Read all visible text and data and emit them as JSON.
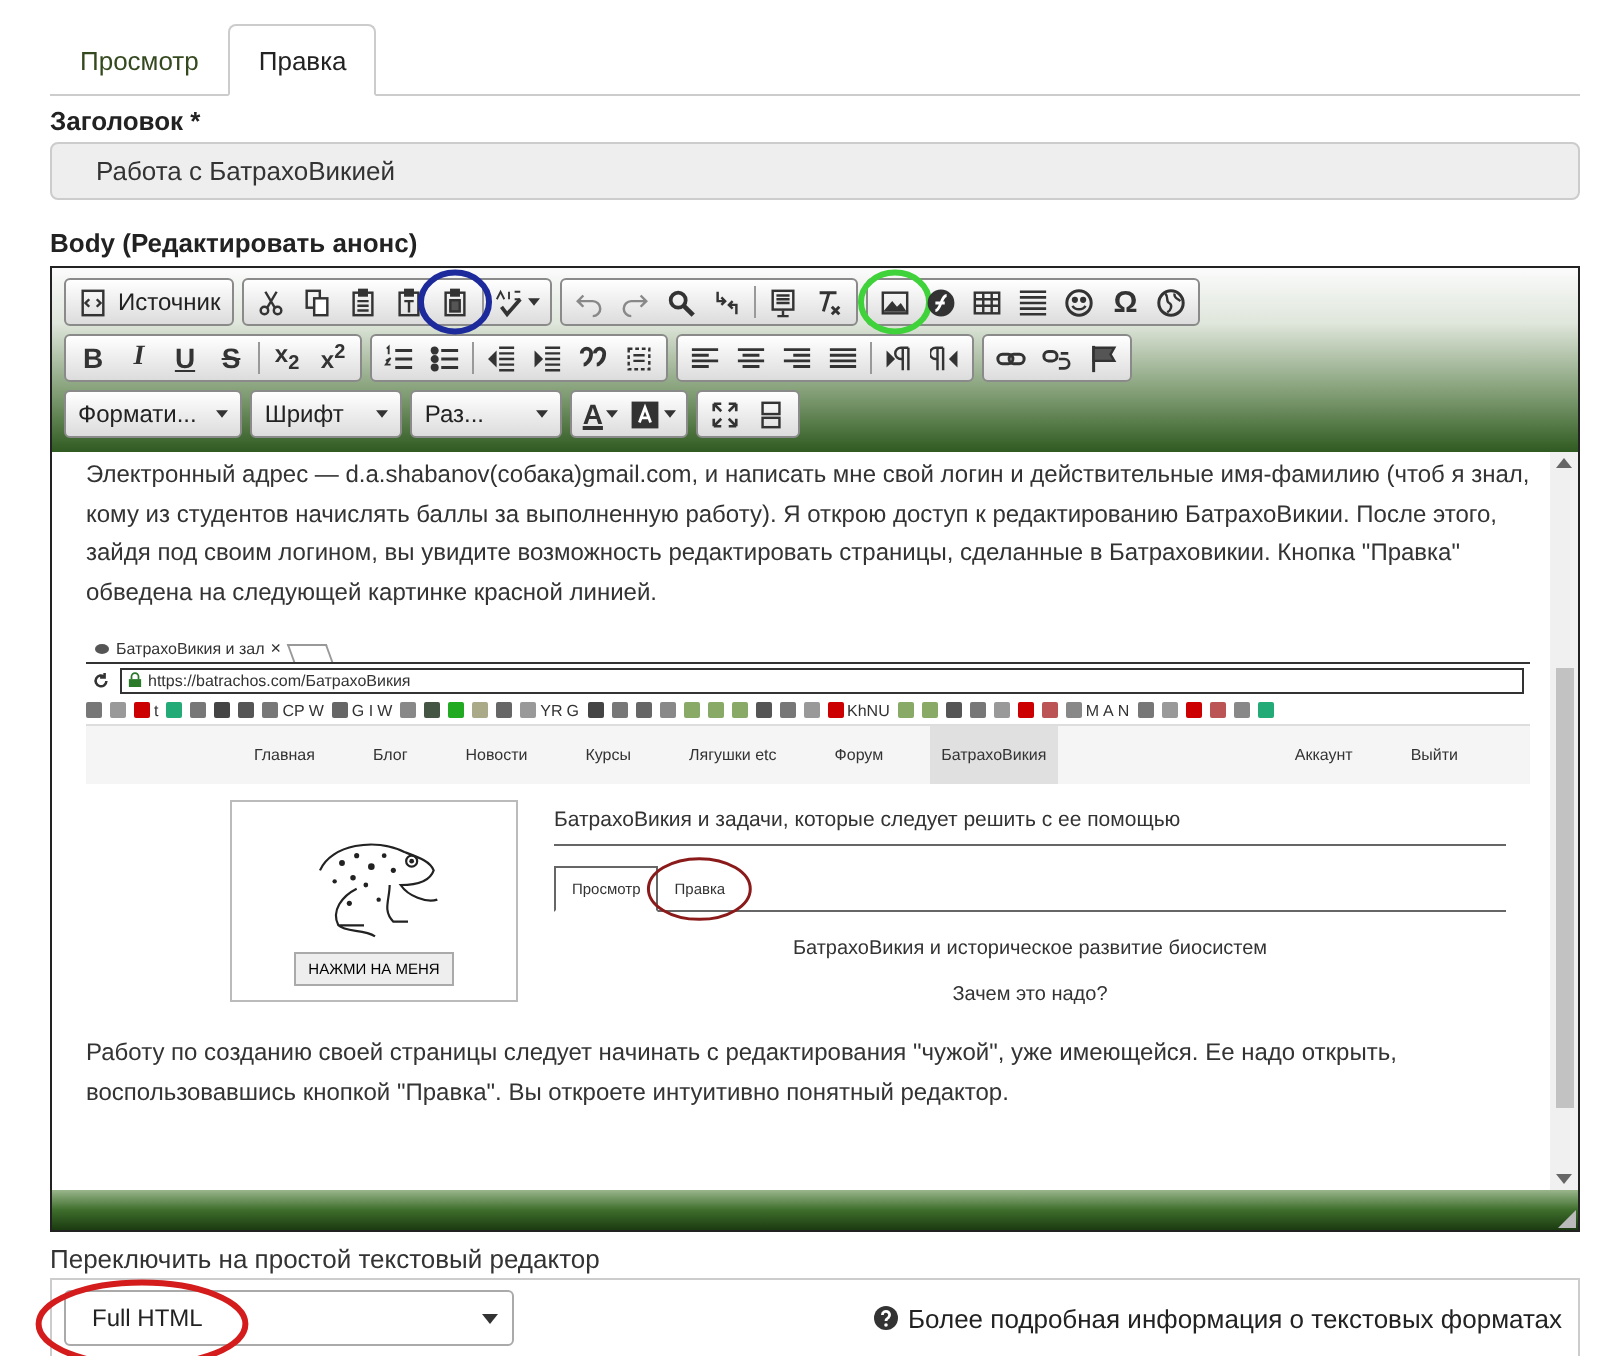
{
  "tabs": [
    {
      "label": "Просмотр",
      "selected": false
    },
    {
      "label": "Правка",
      "selected": true
    }
  ],
  "title_field": {
    "label": "Заголовок",
    "required_mark": "*",
    "value": "Работа с БатрахоВикией"
  },
  "body": {
    "label": "Body (Редактировать анонс)",
    "toolbar": [
      [
        [
          {
            "kind": "label",
            "text": "Источник"
          }
        ],
        [
          {
            "kind": "icon"
          },
          {
            "kind": "icon"
          },
          {
            "kind": "icon"
          },
          {
            "kind": "icon"
          },
          {
            "kind": "icon",
            "annotation": {
              "color": "#1c2a9c"
            }
          },
          {
            "kind": "sep"
          },
          {
            "kind": "icon",
            "menu": true
          }
        ],
        [
          {
            "kind": "icon"
          },
          {
            "kind": "icon"
          },
          {
            "kind": "icon"
          },
          {
            "kind": "icon"
          },
          {
            "kind": "sep"
          },
          {
            "kind": "icon"
          },
          {
            "kind": "icon"
          }
        ],
        [
          {
            "kind": "icon",
            "annotation": {
              "color": "#3fd23a"
            }
          },
          {
            "kind": "icon"
          },
          {
            "kind": "icon"
          },
          {
            "kind": "icon"
          },
          {
            "kind": "icon"
          },
          {
            "kind": "glyph",
            "text": "Ω"
          },
          {
            "kind": "icon"
          }
        ]
      ],
      [
        [
          {
            "kind": "glyph",
            "text": "B"
          },
          {
            "kind": "glyph",
            "text": "I"
          },
          {
            "kind": "glyph",
            "text": "U"
          },
          {
            "kind": "glyph",
            "text": "S"
          },
          {
            "kind": "sep"
          },
          {
            "kind": "glyph",
            "text": "x$_{2}$"
          },
          {
            "kind": "glyph",
            "text": "x$^{2}$"
          }
        ],
        [
          {
            "kind": "icon"
          },
          {
            "kind": "icon"
          },
          {
            "kind": "sep"
          },
          {
            "kind": "icon"
          },
          {
            "kind": "icon"
          },
          {
            "kind": "icon"
          },
          {
            "kind": "icon"
          }
        ],
        [
          {
            "kind": "icon"
          },
          {
            "kind": "icon"
          },
          {
            "kind": "icon"
          },
          {
            "kind": "icon"
          },
          {
            "kind": "sep"
          },
          {
            "kind": "icon"
          },
          {
            "kind": "icon"
          }
        ],
        [
          {
            "kind": "icon"
          },
          {
            "kind": "icon"
          },
          {
            "kind": "icon"
          }
        ]
      ],
      [
        [
          {
            "kind": "combo",
            "text": "Формати...",
            "menu": true
          }
        ],
        [
          {
            "kind": "combo",
            "text": "Шрифт",
            "menu": true
          }
        ],
        [
          {
            "kind": "combo",
            "text": "Раз...",
            "menu": true
          }
        ],
        [
          {
            "kind": "glyph",
            "text": "A",
            "menu": true
          },
          {
            "kind": "icon",
            "menu": true
          }
        ],
        [
          {
            "kind": "icon"
          },
          {
            "kind": "icon"
          }
        ]
      ]
    ],
    "paragraph_1": "Электронный адрес — d.a.shabanov(собака)gmail.com, и написать мне свой логин и действительные имя-фамилию (чтоб я знал, кому из студентов начислять баллы за выполненную работу). Я открою доступ к редактированию БатрахоВикии. После этого, зайдя под своим логином, вы увидите возможность редактировать страницы, сделанные в Батраховикии. Кнопка \"Правка\" обведена на следующей картинке красной линией.",
    "screenshot": {
      "browser_tab": "БатрахоВикия и зал",
      "tab_close": "×",
      "url": "https://batrachos.com/БатрахоВикия",
      "bookmarks": [
        "t",
        "CP",
        "W",
        "G I",
        "W",
        "YR",
        "G",
        "KhNU",
        "M",
        "A",
        "N"
      ],
      "nav": [
        {
          "label": "Главная",
          "selected": false
        },
        {
          "label": "Блог",
          "selected": false
        },
        {
          "label": "Новости",
          "selected": false
        },
        {
          "label": "Курсы",
          "selected": false
        },
        {
          "label": "Лягушки etc",
          "selected": false
        },
        {
          "label": "Форум",
          "selected": false
        },
        {
          "label": "БатрахоВикия",
          "selected": true
        }
      ],
      "nav_right": [
        "Аккаунт",
        "Выйти"
      ],
      "card_button": "НАЖМИ НА МЕНЯ",
      "heading": "БатрахоВикия и задачи, которые следует решить с ее помощью",
      "tabs": [
        {
          "label": "Просмотр",
          "selected": true
        },
        {
          "label": "Правка",
          "selected": false,
          "annotation": {
            "color": "#8b1a1a"
          }
        }
      ],
      "subtitle": "БатрахоВикия и историческое развитие биосистем",
      "question": "Зачем это надо?"
    },
    "paragraph_2": "Работу по созданию своей страницы следует начинать с редактирования \"чужой\", уже имеющейся. Ее надо открыть, воспользовавшись кнопкой \"Правка\". Вы откроете интуитивно понятный редактор."
  },
  "switch_link": "Переключить на простой текстовый редактор",
  "text_format": {
    "value": "Full HTML",
    "annotation": {
      "color": "#d41c1c"
    },
    "help": "Более подробная информация о текстовых форматах"
  }
}
